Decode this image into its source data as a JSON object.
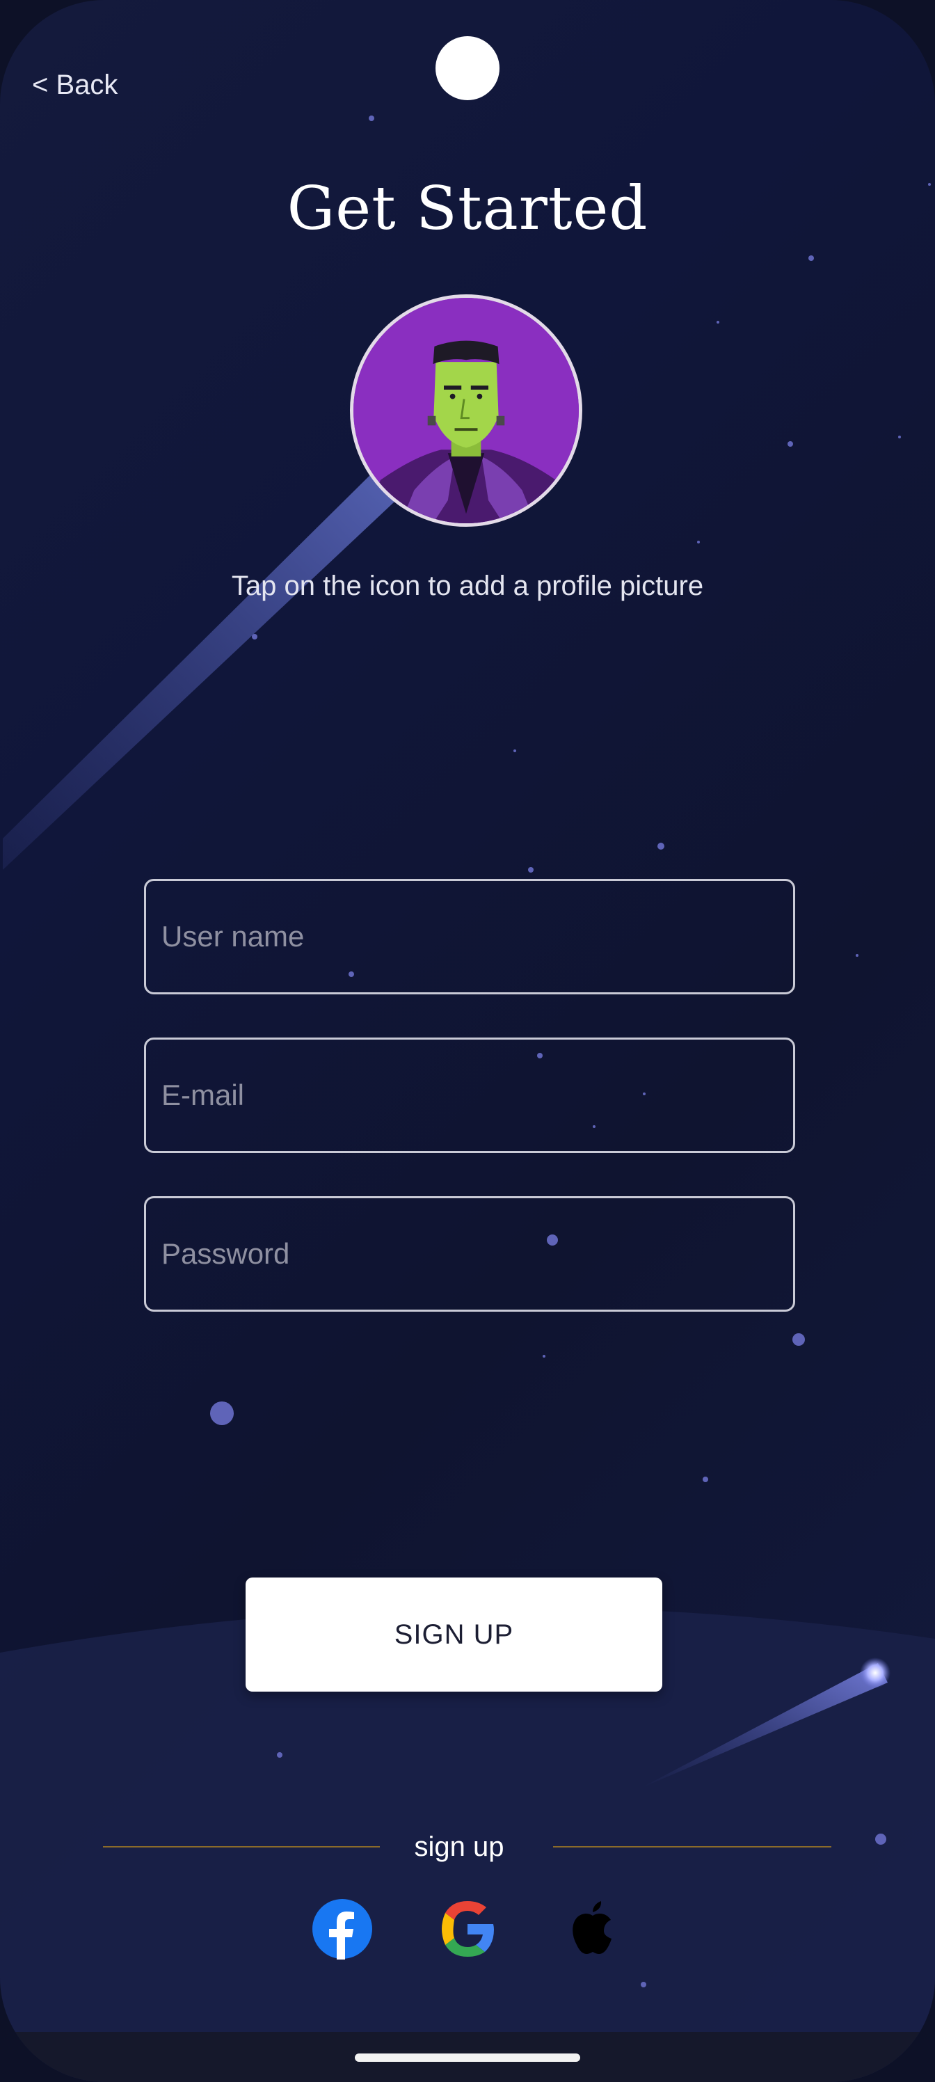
{
  "header": {
    "back_label": "< Back",
    "title": "Get Started"
  },
  "profile": {
    "hint": "Tap on the icon to add a profile picture",
    "avatar_icon": "frankenstein-avatar"
  },
  "form": {
    "username_placeholder": "User name",
    "email_placeholder": "E-mail",
    "password_placeholder": "Password",
    "submit_label": "SIGN UP"
  },
  "social": {
    "divider_label": "sign up",
    "providers": [
      {
        "name": "facebook-icon",
        "color": "#1877f2"
      },
      {
        "name": "google-icon",
        "color": "#4285f4"
      },
      {
        "name": "apple-icon",
        "color": "#000000"
      }
    ]
  },
  "theme": {
    "background": "#0f1430",
    "star_color": "#5f64b8",
    "avatar_bg": "#8a2fc0",
    "button_bg": "#ffffff",
    "divider_color": "#8a6a2a"
  }
}
